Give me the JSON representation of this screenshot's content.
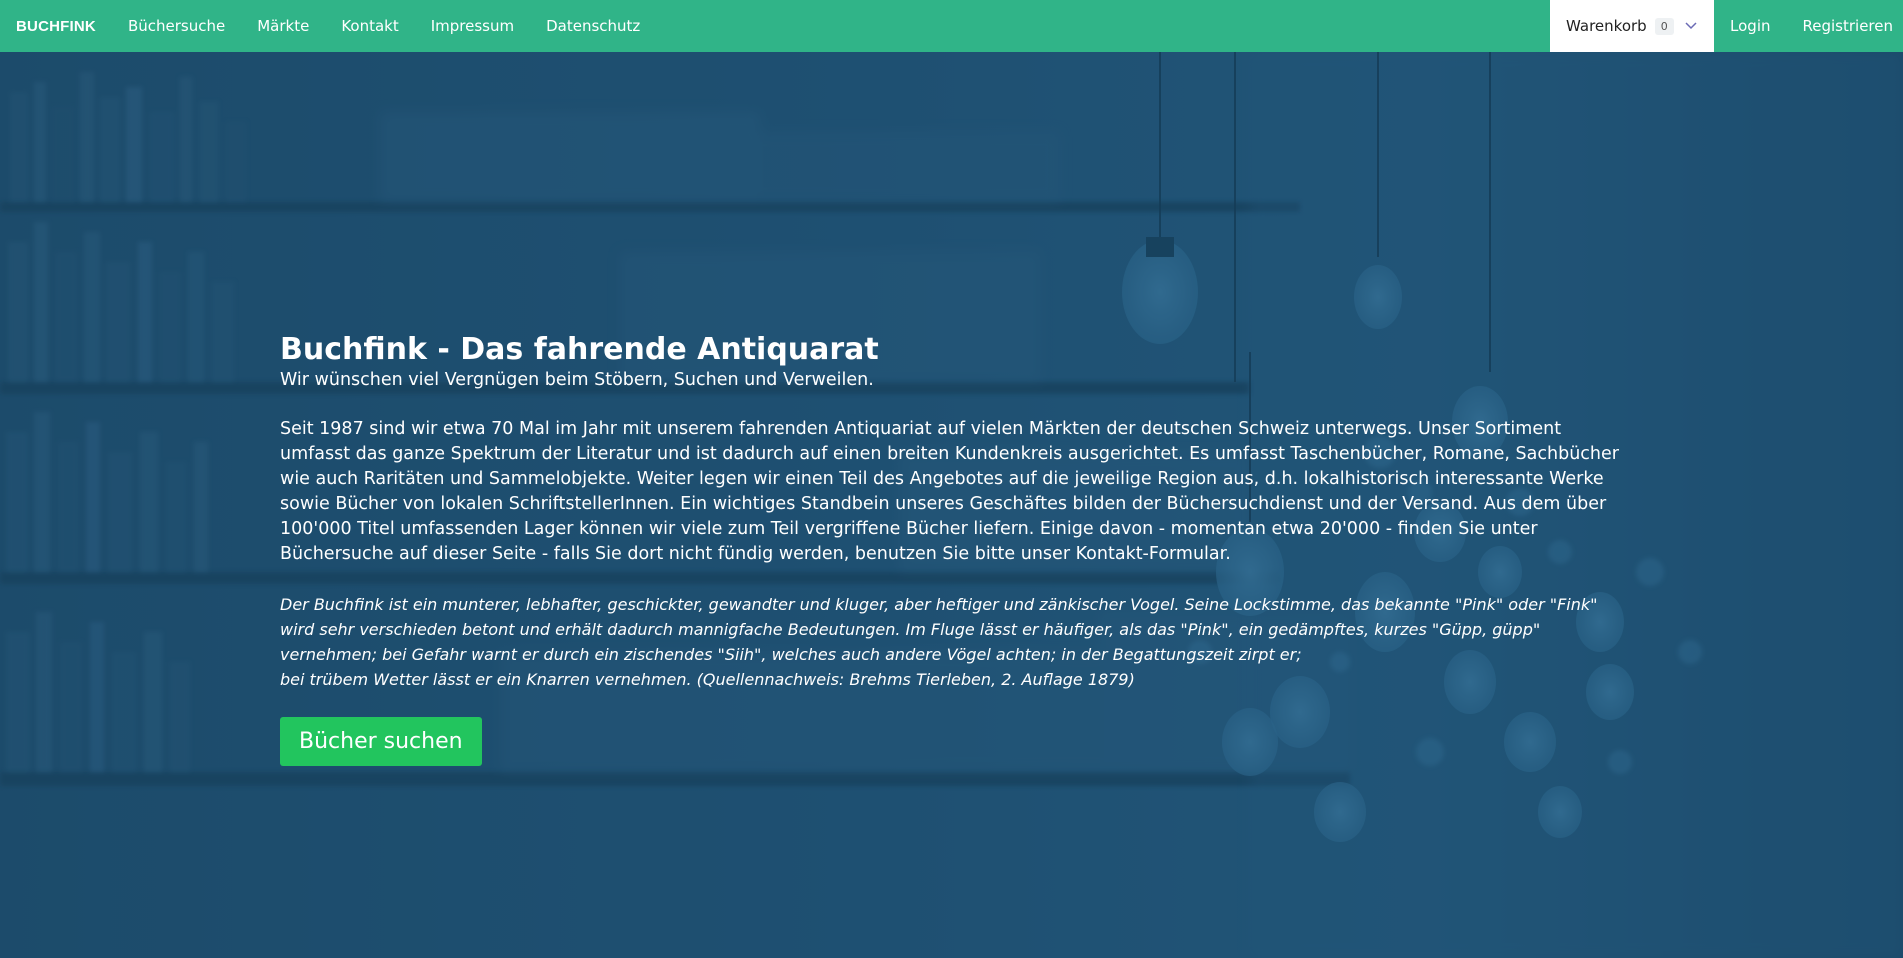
{
  "nav": {
    "brand": "BUCHFINK",
    "links": [
      "Büchersuche",
      "Märkte",
      "Kontakt",
      "Impressum",
      "Datenschutz"
    ],
    "cart": {
      "label": "Warenkorb",
      "count": "0"
    },
    "login": "Login",
    "register": "Registrieren",
    "colors": {
      "navbar": "#30b488",
      "cta": "#22c55e",
      "hero_tint": "#1d4f6f"
    }
  },
  "hero": {
    "title": "Buchfink - Das fahrende Antiquarat",
    "subtitle": "Wir wünschen viel Vergnügen beim Stöbern, Suchen und Verweilen.",
    "intro": "Seit 1987 sind wir etwa 70 Mal im Jahr mit unserem fahrenden Antiquariat auf vielen Märkten der deutschen Schweiz unterwegs. Unser Sortiment umfasst das ganze Spektrum der Literatur und ist dadurch auf einen breiten Kundenkreis ausgerichtet. Es umfasst Taschenbücher, Romane, Sachbücher wie auch Raritäten und Sammelobjekte. Weiter legen wir einen Teil des Angebotes auf die jeweilige Region aus, d.h. lokalhistorisch interessante Werke sowie Bücher von lokalen SchriftstellerInnen. Ein wichtiges Standbein unseres Geschäftes bilden der Büchersuchdienst und der Versand. Aus dem über 100'000 Titel umfassenden Lager können wir viele zum Teil vergriffene Bücher liefern. Einige davon - momentan etwa 20'000 - finden Sie unter Büchersuche auf dieser Seite - falls Sie dort nicht fündig werden, benutzen Sie bitte unser Kontakt-Formular.",
    "quote_line1": "Der Buchfink ist ein munterer, lebhafter, geschickter, gewandter und kluger, aber heftiger und zänkischer Vogel. Seine Lockstimme, das bekannte \"Pink\" oder \"Fink\" wird sehr verschieden betont und erhält dadurch mannigfache Bedeutungen. Im Fluge lässt er häufiger, als das \"Pink\", ein gedämpftes, kurzes \"Güpp, güpp\" vernehmen; bei Gefahr warnt er durch ein zischendes \"Siih\", welches auch andere Vögel achten; in der Begattungszeit zirpt er;",
    "quote_line2": "bei trübem Wetter lässt er ein Knarren vernehmen. (Quellennachweis: Brehms Tierleben, 2. Auflage 1879)",
    "cta": "Bücher suchen"
  }
}
